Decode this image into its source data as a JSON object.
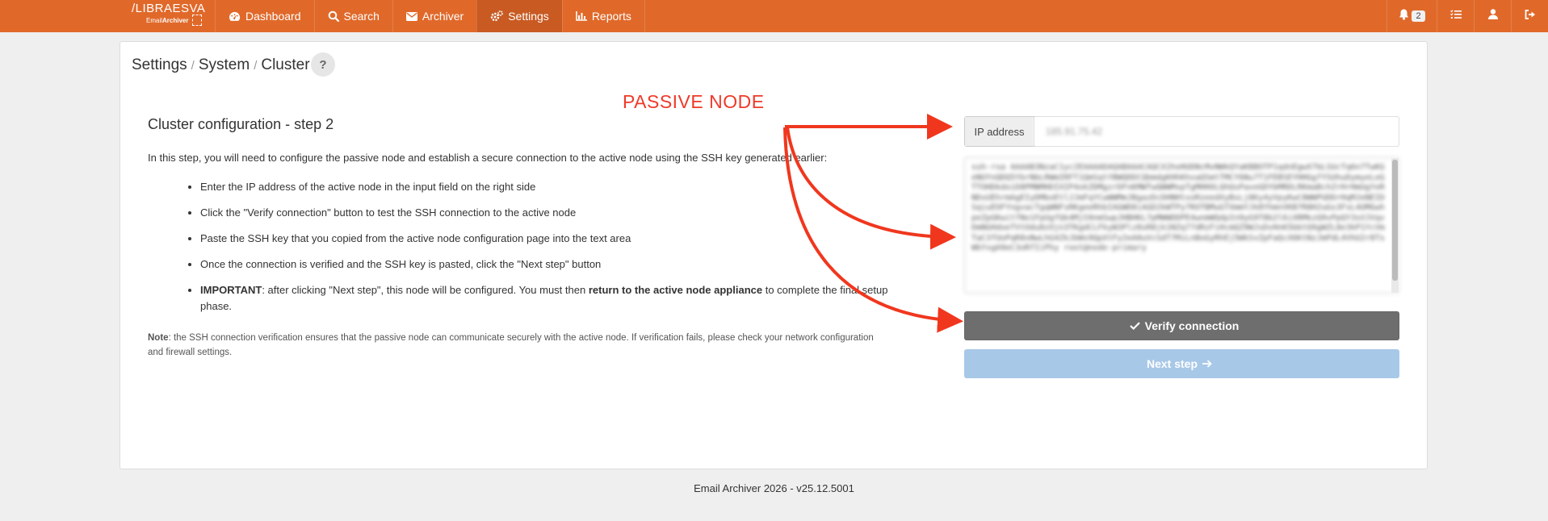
{
  "brand": {
    "name": "/LIBRAESVA",
    "sub_light": "Email",
    "sub_bold": "Archiver"
  },
  "nav": {
    "items": [
      {
        "label": "Dashboard",
        "icon": "gauge-icon"
      },
      {
        "label": "Search",
        "icon": "search-icon"
      },
      {
        "label": "Archiver",
        "icon": "envelope-icon"
      },
      {
        "label": "Settings",
        "icon": "gears-icon",
        "active": true
      },
      {
        "label": "Reports",
        "icon": "chart-icon"
      }
    ],
    "notifications_count": "2"
  },
  "breadcrumb": {
    "part1": "Settings",
    "part2": "System",
    "part3": "Cluster",
    "sep": "/"
  },
  "help_label": "?",
  "annotation": "PASSIVE NODE",
  "content": {
    "title": "Cluster configuration - step 2",
    "intro": "In this step, you will need to configure the passive node and establish a secure connection to the active node using the SSH key generated earlier:",
    "steps": [
      "Enter the IP address of the active node in the input field on the right side",
      "Click the \"Verify connection\" button to test the SSH connection to the active node",
      "Paste the SSH key that you copied from the active node configuration page into the text area",
      "Once the connection is verified and the SSH key is pasted, click the \"Next step\" button"
    ],
    "important": {
      "label": "IMPORTANT",
      "text1": ": after clicking \"Next step\", this node will be configured. You must then ",
      "bold2": "return to the active node appliance",
      "text2": " to complete the final setup phase."
    },
    "note": {
      "label": "Note",
      "text": ": the SSH connection verification ensures that the passive node can communicate securely with the active node. If verification fails, please check your network configuration and firewall settings."
    }
  },
  "form": {
    "ip_label": "IP address",
    "ip_value": "185.91.75.42",
    "ssh_key": "ssh-rsa AAAAB3NzaC1yc2EAAAADAQABAAACAQCX2hoHUDNcMvNWkQYaKBBOTP1qdnEgwX7bLSUcTq6n7TwKGeNUYnQDQ5YbrNbLRWmIRFT1QmSqtYBWQDDCQbmdgKHhKhxaQSmtTMCY6Nu7T1FEBSEYHHGgfYSUhuDymyeLeGTTOHDkdoiD8PMNMHDIXIP4okZDMgzrDFnKMWTwQWWMxpTgMHHOLQhQsPaxeGDYbMRDLRKmaBchZrHrHmUgYeRNDxUEhrmAgEIyDMboEtlJJmFqYCwWWMmJBgazDcDHNHtxoRzeedXyBsLj8Ky4yVpyKwC8WWPUDDrHqMJeNEIDSqiuEOFYngvacTgqWNFsRKgeeRhbIAGWD8iAGD2kWTPy7ROTBMuGTXmmYJk8YhmnVKB7R8H2uGs3FsL4UMGwhpeZpGKwitfNo1FpUgfQk4MjS9nmSwpJHBHKL7pMWWDDPE4wnmWQdpIn9yG9T8b2l6iXRMkzQ9vPpQY3sVJVqvDmNGHdoeTVtOdu8zOjn3TKgdCLFkyW3Plz8sR8jk1NZq77dRzFiHcmQZ9WJsDvHnK5bbtQ9gWZL8e3kP1YcVmTaC3fUoPqR8xNwLhG4ZkJbWs9QpXtFy2eA0uVcSdT7MiLnBoGyRhEj5WkSvZpFaQcX6KtNzJmPdL4VhU2r8TsWbYxgA9eC3oRfIiPhy root@node-primary"
  },
  "buttons": {
    "verify": "Verify connection",
    "next": "Next step"
  },
  "footer": "Email Archiver 2026 - v25.12.5001",
  "colors": {
    "navbar": "#e0692a",
    "active_tab": "#c85a22",
    "annotation": "#ee3a2a",
    "verify_btn": "#6e6e6e",
    "next_btn": "#a8c8e8"
  }
}
